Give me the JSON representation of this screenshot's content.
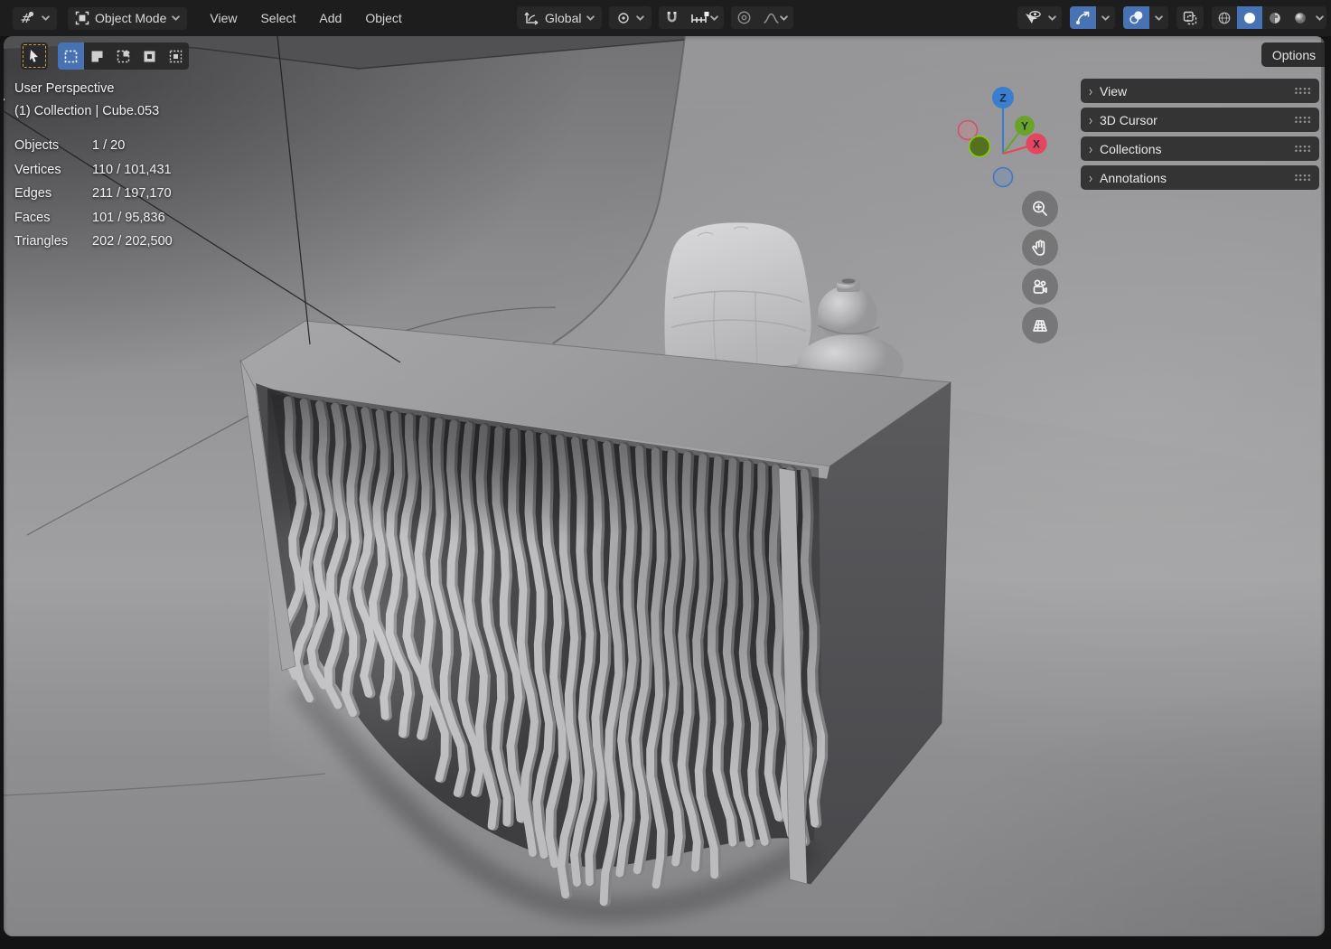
{
  "header": {
    "mode_label": "Object Mode",
    "menus": [
      "View",
      "Select",
      "Add",
      "Object"
    ],
    "orientation_label": "Global",
    "options_label": "Options"
  },
  "viewport_overlay": {
    "perspective_label": "User Perspective",
    "breadcrumb": "(1) Collection | Cube.053",
    "stats": [
      {
        "label": "Objects",
        "value": "1 / 20"
      },
      {
        "label": "Vertices",
        "value": "110 / 101,431"
      },
      {
        "label": "Edges",
        "value": "211 / 197,170"
      },
      {
        "label": "Faces",
        "value": "101 / 95,836"
      },
      {
        "label": "Triangles",
        "value": "202 / 202,500"
      }
    ]
  },
  "sidebar_tabs": [
    {
      "label": "View"
    },
    {
      "label": "3D Cursor"
    },
    {
      "label": "Collections"
    },
    {
      "label": "Annotations"
    }
  ],
  "gizmo": {
    "z": "Z",
    "y": "Y",
    "x": "X"
  },
  "colors": {
    "accent_blue": "#4772b3",
    "active_tool_dash": "#cf9c3f",
    "axis_x": "#e5455e",
    "axis_y": "#6ba32a",
    "axis_z": "#3a7ecf"
  }
}
